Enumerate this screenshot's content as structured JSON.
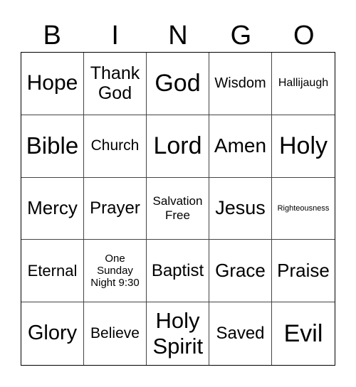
{
  "header": [
    "B",
    "I",
    "N",
    "G",
    "O"
  ],
  "cells": [
    "Hope",
    "Thank God",
    "God",
    "Wisdom",
    "Hallijaugh",
    "Bible",
    "Church",
    "Lord",
    "Amen",
    "Holy",
    "Mercy",
    "Prayer",
    "Salvation Free",
    "Jesus",
    "Righteousness",
    "Eternal",
    "One Sunday Night 9:30",
    "Baptist",
    "Grace",
    "Praise",
    "Glory",
    "Believe",
    "Holy Spirit",
    "Saved",
    "Evil"
  ]
}
